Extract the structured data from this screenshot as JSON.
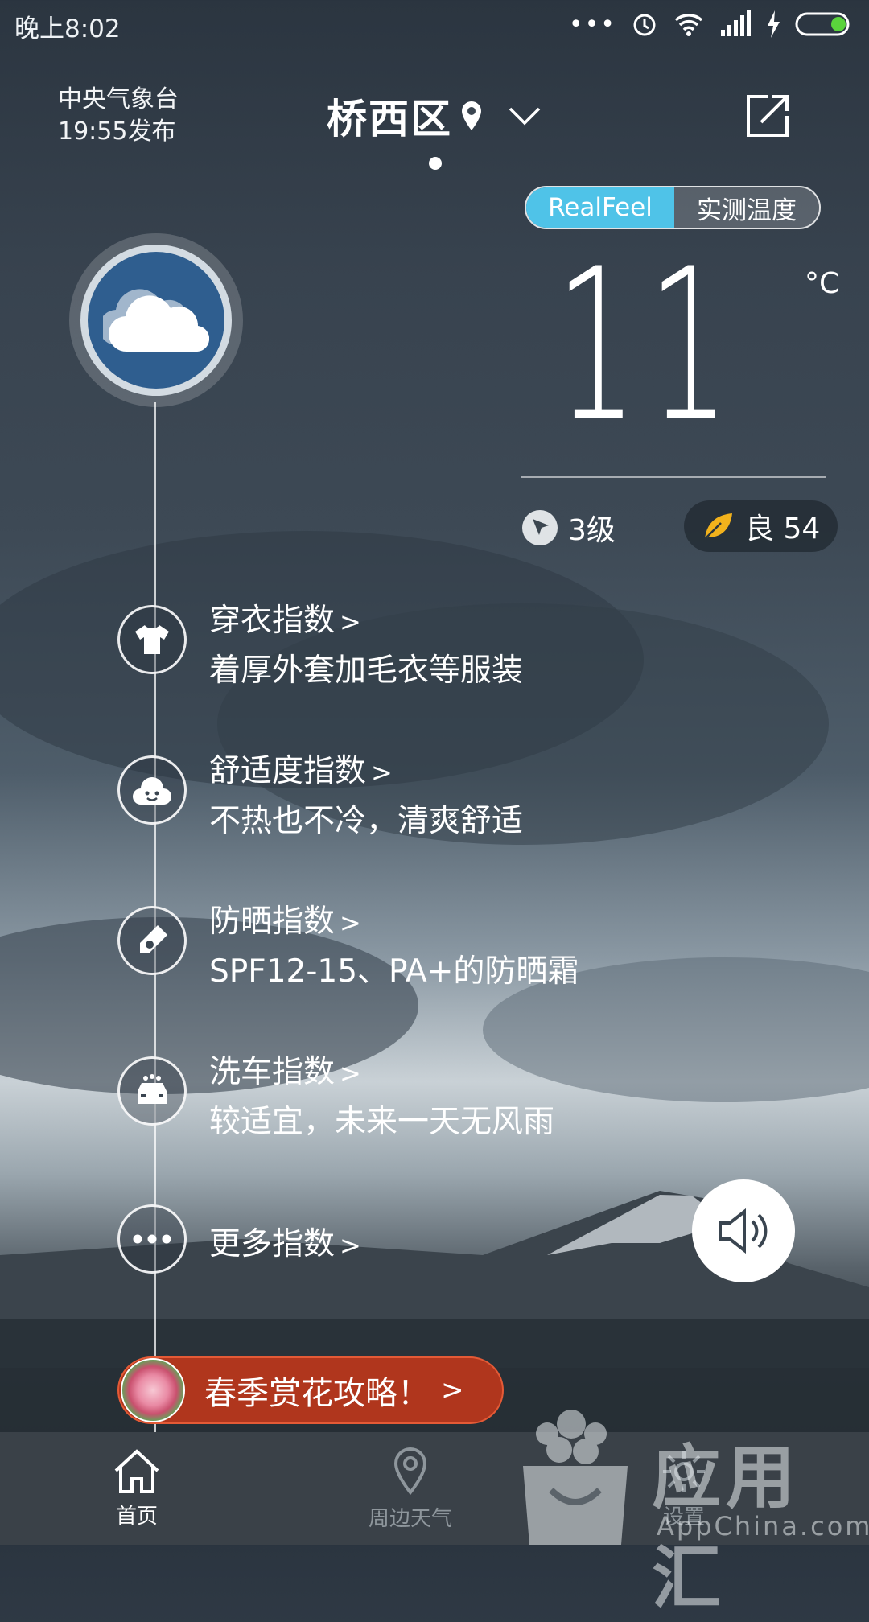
{
  "status_bar": {
    "time": "晚上8:02"
  },
  "header": {
    "publisher": "中央气象台",
    "publish_time": "19:55发布",
    "city": "桥西区"
  },
  "toggle": {
    "realfeel": "RealFeel",
    "measured": "实测温度"
  },
  "current": {
    "temperature": "11",
    "unit": "°C",
    "wind": "3级",
    "aqi": "良 54"
  },
  "indices": [
    {
      "title": "穿衣指数",
      "desc": "着厚外套加毛衣等服装",
      "icon": "tshirt-icon"
    },
    {
      "title": "舒适度指数",
      "desc": "不热也不冷，清爽舒适",
      "icon": "smiley-icon"
    },
    {
      "title": "防晒指数",
      "desc": "SPF12-15、PA+的防晒霜",
      "icon": "sunscreen-icon"
    },
    {
      "title": "洗车指数",
      "desc": "较适宜，未来一天无风雨",
      "icon": "car-wash-icon"
    },
    {
      "title": "更多指数",
      "desc": "",
      "icon": "more-icon"
    }
  ],
  "chevron": ">",
  "promo": {
    "label": "春季赏花攻略！"
  },
  "nav": [
    {
      "label": "首页",
      "icon": "home-icon"
    },
    {
      "label": "周边天气",
      "icon": "location-icon"
    },
    {
      "label": "设置",
      "icon": "gear-icon"
    }
  ],
  "watermark": {
    "brand": "应用汇",
    "site": "AppChina.com"
  },
  "colors": {
    "accent": "#4fc3e8",
    "promo": "#b0361d",
    "weather_badge": "#2f5e8f",
    "aqi_leaf": "#f2b21c"
  }
}
